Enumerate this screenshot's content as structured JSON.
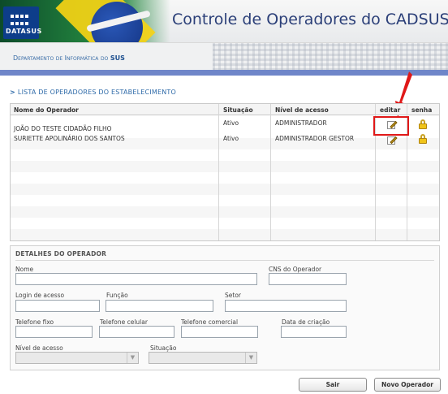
{
  "header": {
    "logo_text": "DATASUS",
    "title": "Controle de Operadores do CADSUS WEB",
    "department_prefix": "Departamento de Informática do",
    "department_suffix": "SUS"
  },
  "section": {
    "arrow": ">",
    "title": "LISTA DE OPERADORES DO ESTABELECIMENTO"
  },
  "table": {
    "columns": {
      "name": "Nome do Operador",
      "status": "Situação",
      "level": "Nível de acesso",
      "edit": "editar",
      "password": "senha"
    },
    "rows": [
      {
        "name": "JOÃO DO TESTE CIDADÃO FILHO",
        "status": "Ativo",
        "level": "ADMINISTRADOR"
      },
      {
        "name": "SURIETTE APOLINÁRIO DOS SANTOS",
        "status": "Ativo",
        "level": "ADMINISTRADOR GESTOR"
      }
    ]
  },
  "details": {
    "title": "DETALHES DO OPERADOR",
    "labels": {
      "name": "Nome",
      "cns": "CNS do Operador",
      "login": "Login de acesso",
      "role": "Função",
      "sector": "Setor",
      "phone": "Telefone fixo",
      "mobile": "Telefone celular",
      "work_phone": "Telefone comercial",
      "created": "Data de criação",
      "level": "Nível de acesso",
      "status": "Situação"
    }
  },
  "buttons": {
    "exit": "Sair",
    "new_operator": "Novo Operador"
  },
  "colors": {
    "accent": "#2e6aa8",
    "highlight": "#e01818",
    "band": "#6f86c9"
  }
}
